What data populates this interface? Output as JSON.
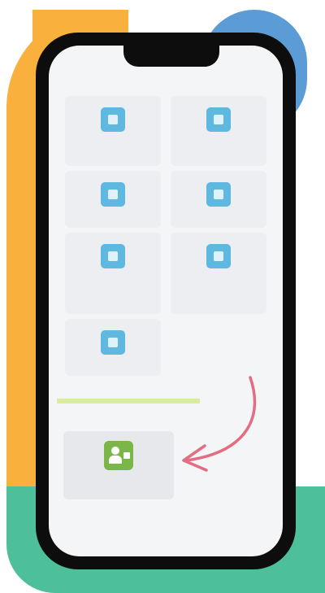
{
  "screen": {
    "section_title": "",
    "menu_label": "",
    "tiles": [
      {
        "icon": "plus-square-icon",
        "label": ""
      },
      {
        "icon": "monitor-icon",
        "label": ""
      },
      {
        "icon": "calendar-icon",
        "label": ""
      },
      {
        "icon": "transfer-icon",
        "label": ""
      },
      {
        "icon": "document-icon",
        "label": ""
      },
      {
        "icon": "chart-icon",
        "label": ""
      },
      {
        "icon": "id-card-icon",
        "label": ""
      }
    ],
    "feature_tile": {
      "icon": "add-user-icon",
      "label": ""
    }
  },
  "colors": {
    "orange": "#f9b03c",
    "blue": "#5b9cd6",
    "green": "#4dbf9a",
    "tile_icon": "#5fb8e0",
    "feature_icon": "#7ab648",
    "arrow": "#e36d83",
    "highlight": "#d8ec9a"
  }
}
